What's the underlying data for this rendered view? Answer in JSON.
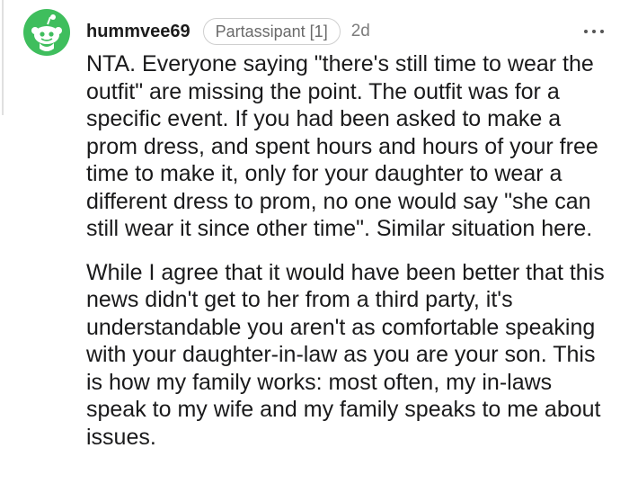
{
  "comment": {
    "username": "hummvee69",
    "flair": "Partassipant [1]",
    "age": "2d",
    "paragraphs": [
      "NTA. Everyone saying \"there's still time to wear the outfit\" are missing the point. The outfit was for a specific event. If you had been asked to make a prom dress, and spent hours and hours of your free time to make it, only for your daughter to wear a different dress to prom, no one would say \"she can still wear it since other time\". Similar situation here.",
      "While I agree that it would have been better that this news didn't get to her from a third party, it's understandable you aren't as comfortable speaking with your daughter-in-law as you are your son. This is how my family works: most often, my in-laws speak to my wife and my family speaks to me about issues."
    ]
  },
  "icons": {
    "avatar": "snoo-avatar-icon",
    "more": "more-options-icon"
  },
  "colors": {
    "avatar_green": "#3fbe5d",
    "username": "#1c1c1c",
    "meta": "#7c7c7c",
    "body_text": "#1a1a1b"
  }
}
